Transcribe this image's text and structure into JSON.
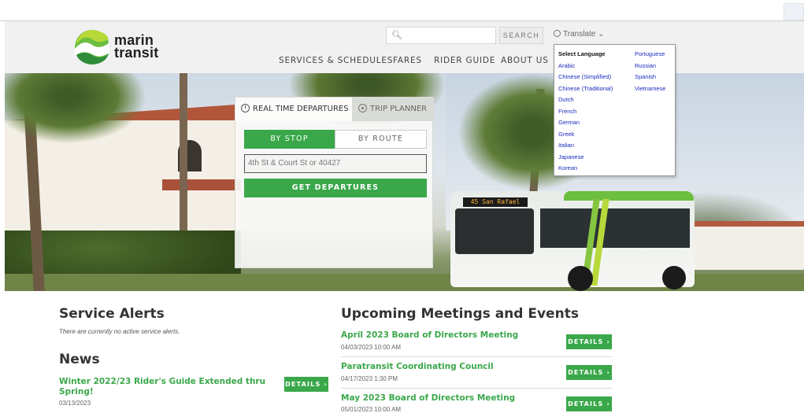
{
  "header": {
    "logo_line1": "marin",
    "logo_line2": "transit",
    "search_placeholder": "",
    "search_button": "SEARCH",
    "translate_label": "Translate"
  },
  "nav": {
    "items": [
      {
        "label": "SERVICES & SCHEDULES"
      },
      {
        "label": "FARES"
      },
      {
        "label": "RIDER GUIDE"
      },
      {
        "label": "ABOUT US"
      }
    ]
  },
  "hero": {
    "bus_sign": "45 San Rafael"
  },
  "trip_widget": {
    "tab_realtime": "REAL TIME DEPARTURES",
    "tab_planner": "TRIP PLANNER",
    "seg_by_stop": "BY STOP",
    "seg_by_route": "BY ROUTE",
    "stop_input_placeholder": "4th St & Court St or 40427",
    "get_departures": "GET DEPARTURES"
  },
  "translate_menu": {
    "col1": [
      "Select Language",
      "Arabic",
      "Chinese (Simplified)",
      "Chinese (Traditional)",
      "Dutch",
      "French",
      "German",
      "Greek",
      "Italian",
      "Japanese",
      "Korean"
    ],
    "col2": [
      "Portuguese",
      "Russian",
      "Spanish",
      "Vietnamese"
    ]
  },
  "alerts": {
    "title": "Service Alerts",
    "note": "There are currently no active service alerts."
  },
  "news": {
    "title": "News",
    "items": [
      {
        "title": "Winter 2022/23 Rider's Guide Extended thru Spring!",
        "date": "03/13/2023",
        "button": "DETAILS"
      }
    ]
  },
  "events": {
    "title": "Upcoming Meetings and Events",
    "items": [
      {
        "title": "April 2023 Board of Directors Meeting",
        "date": "04/03/2023 10:00 AM",
        "button": "DETAILS"
      },
      {
        "title": "Paratransit Coordinating Council",
        "date": "04/17/2023 1:30 PM",
        "button": "DETAILS"
      },
      {
        "title": "May 2023 Board of Directors Meeting",
        "date": "05/01/2023 10:00 AM",
        "button": "DETAILS"
      }
    ]
  },
  "colors": {
    "brand_green": "#3aa84a",
    "link_blue": "#1a2bbd"
  }
}
